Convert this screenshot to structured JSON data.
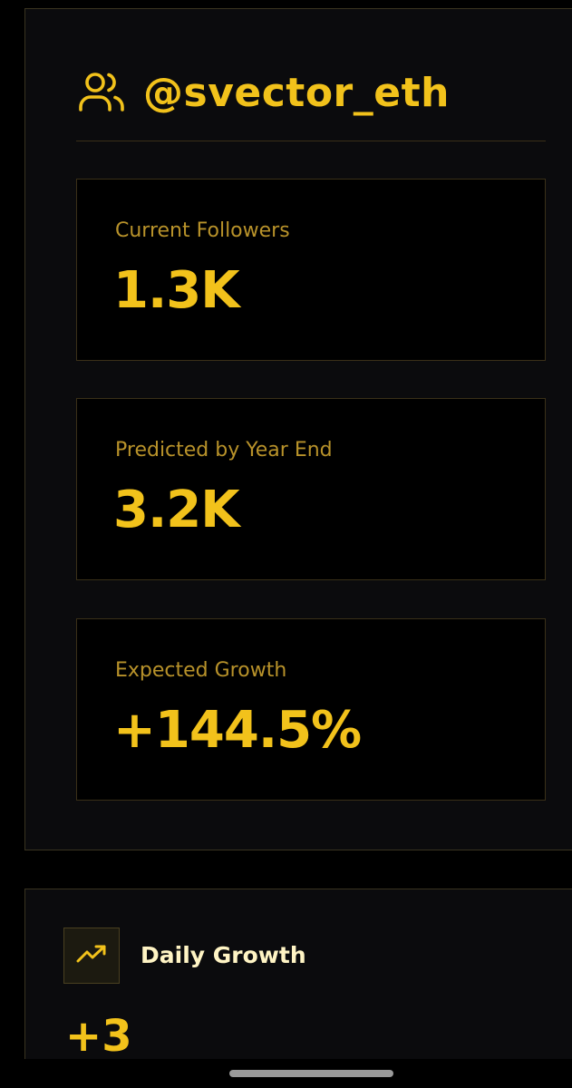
{
  "profile": {
    "icon": "users-icon",
    "handle": "@svector_eth"
  },
  "stats": [
    {
      "label": "Current Followers",
      "value": "1.3K"
    },
    {
      "label": "Predicted by Year End",
      "value": "3.2K"
    },
    {
      "label": "Expected Growth",
      "value": "+144.5%"
    }
  ],
  "growth": {
    "icon": "trending-up-icon",
    "title": "Daily Growth",
    "value": "+3"
  },
  "colors": {
    "accent": "#f2c21b",
    "label": "#b8922a",
    "background": "#000000",
    "card": "#0b0b0d",
    "border": "#3a3018"
  }
}
